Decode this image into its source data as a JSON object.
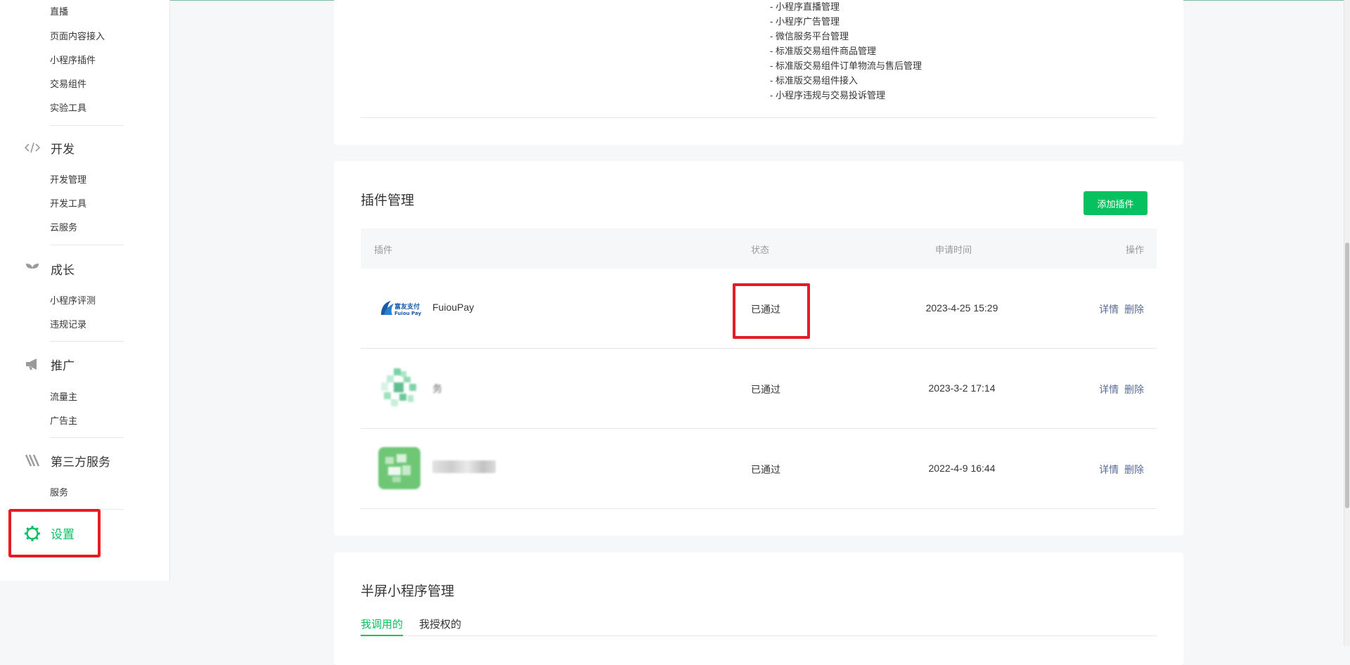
{
  "sidebar": {
    "sub_items_top": [
      "直播",
      "页面内容接入",
      "小程序插件",
      "交易组件",
      "实验工具"
    ],
    "groups": [
      {
        "icon": "code-icon",
        "label": "开发",
        "items": [
          "开发管理",
          "开发工具",
          "云服务"
        ]
      },
      {
        "icon": "sprout-icon",
        "label": "成长",
        "items": [
          "小程序评测",
          "违规记录"
        ]
      },
      {
        "icon": "megaphone-icon",
        "label": "推广",
        "items": [
          "流量主",
          "广告主"
        ]
      },
      {
        "icon": "third-party-icon",
        "label": "第三方服务",
        "items": [
          "服务"
        ]
      }
    ],
    "settings": {
      "icon": "gear-icon",
      "label": "设置"
    }
  },
  "permissions": [
    "- 小程序直播管理",
    "- 小程序广告管理",
    "- 微信服务平台管理",
    "- 标准版交易组件商品管理",
    "- 标准版交易组件订单物流与售后管理",
    "- 标准版交易组件接入",
    "- 小程序违规与交易投诉管理"
  ],
  "plugin_section": {
    "title": "插件管理",
    "add_button": "添加插件",
    "headers": {
      "plugin": "插件",
      "status": "状态",
      "time": "申请时间",
      "action": "操作"
    },
    "rows": [
      {
        "name": "FuiouPay",
        "logo_text_cn": "富友支付",
        "logo_text_en": "Fuiou Pay",
        "status": "已通过",
        "time": "2023-4-25 15:29",
        "detail": "详情",
        "delete": "删除"
      },
      {
        "name": "务",
        "status": "已通过",
        "time": "2023-3-2 17:14",
        "detail": "详情",
        "delete": "删除"
      },
      {
        "name": "",
        "status": "已通过",
        "time": "2022-4-9 16:44",
        "detail": "详情",
        "delete": "删除"
      }
    ]
  },
  "half_screen": {
    "title": "半屏小程序管理",
    "tabs": [
      "我调用的",
      "我授权的"
    ]
  },
  "colors": {
    "accent": "#07c160",
    "link": "#576b95",
    "highlight": "#e51c23"
  }
}
